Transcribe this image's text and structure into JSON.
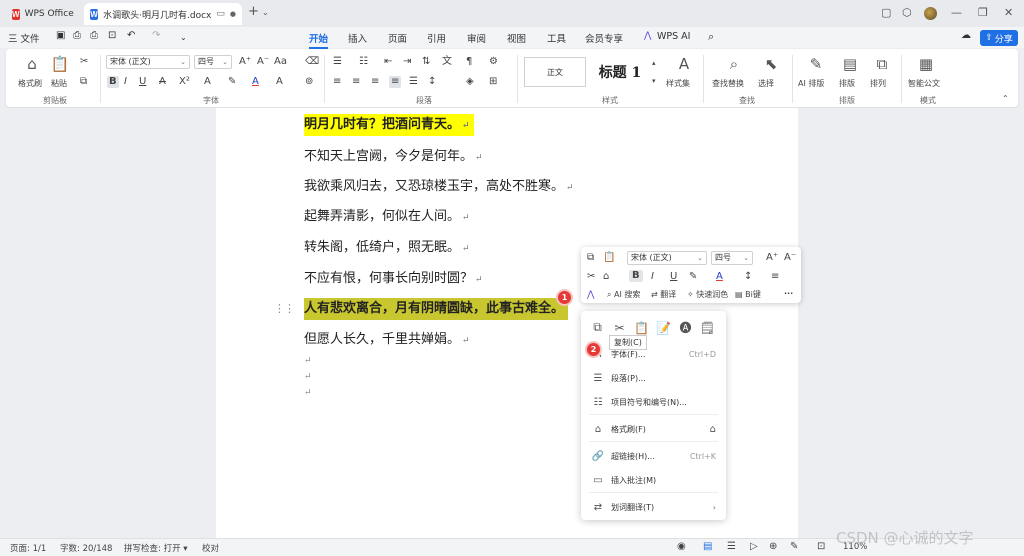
{
  "titlebar": {
    "app_tab": "WPS Office",
    "doc_tab": "水调歌头·明月几时有.docx",
    "new_tab": "+"
  },
  "menubar": {
    "file": "三 文件",
    "tabs": [
      "开始",
      "插入",
      "页面",
      "引用",
      "审阅",
      "视图",
      "工具",
      "会员专享",
      "WPS AI"
    ],
    "active_tab": "开始",
    "share": "分享"
  },
  "ribbon": {
    "clipboard": {
      "format_painter": "格式刷",
      "paste": "粘贴",
      "group": "剪贴板"
    },
    "font": {
      "name": "宋体 (正文)",
      "size": "四号",
      "group": "字体"
    },
    "paragraph": {
      "group": "段落"
    },
    "styles": {
      "normal": "正文",
      "heading": "标题 1",
      "style_set": "样式集",
      "group": "样式"
    },
    "find": {
      "find_replace": "查找替换",
      "select": "选择",
      "group": "查找"
    },
    "layout": {
      "ai_layout": "AI 排版",
      "layout": "排版",
      "sort": "排列",
      "group": "排版"
    },
    "template": {
      "smart_doc": "智能公文",
      "group": "模式"
    }
  },
  "document": {
    "lines": [
      "明月几时有？把酒问青天。",
      "不知天上宫阙，今夕是何年。",
      "我欲乘风归去，又恐琼楼玉宇，高处不胜寒。",
      "起舞弄清影，何似在人间。",
      "转朱阁，低绮户，照无眠。",
      "不应有恨，何事长向别时圆？",
      "人有悲欢离合，月有阴晴圆缺，此事古难全。",
      "但愿人长久，千里共婵娟。"
    ],
    "para_mark": "↵"
  },
  "mini_toolbar": {
    "font": "宋体 (正文)",
    "size": "四号",
    "ai_search": "AI 搜索",
    "translate": "翻译",
    "quick_polish": "快速润色",
    "count": "Bi键",
    "more": "···"
  },
  "context_menu": {
    "tooltip": "复制(C)",
    "items": [
      {
        "label": "字体(F)...",
        "shortcut": "Ctrl+D"
      },
      {
        "label": "段落(P)...",
        "shortcut": ""
      },
      {
        "label": "项目符号和编号(N)...",
        "shortcut": ""
      },
      {
        "label": "格式刷(F)",
        "shortcut": ""
      },
      {
        "label": "超链接(H)...",
        "shortcut": "Ctrl+K"
      },
      {
        "label": "插入批注(M)",
        "shortcut": ""
      },
      {
        "label": "划词翻译(T)",
        "shortcut": ""
      }
    ]
  },
  "badges": {
    "first": "1",
    "second": "2"
  },
  "statusbar": {
    "page": "页面: 1/1",
    "words": "字数: 20/148",
    "spell": "拼写检查: 打开 ▾",
    "proof": "校对",
    "zoom": "110%"
  },
  "watermark": "CSDN @心诚的文字",
  "colors": {
    "accent": "#1f6fe5",
    "highlight": "#ffff00",
    "badge": "#e53935"
  }
}
